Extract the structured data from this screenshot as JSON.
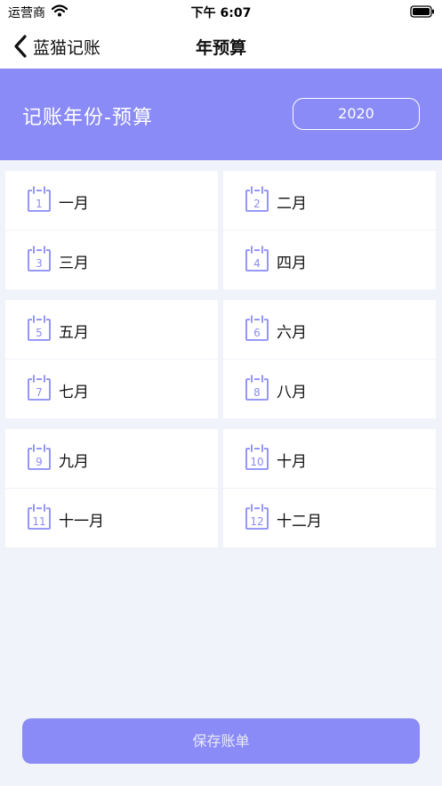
{
  "status_bar": {
    "carrier": "运营商",
    "time": "下午 6:07"
  },
  "nav": {
    "back_label": "蓝猫记账",
    "title": "年预算"
  },
  "banner": {
    "title": "记账年份-预算",
    "year": "2020"
  },
  "months": [
    {
      "num": "1",
      "label": "一月"
    },
    {
      "num": "2",
      "label": "二月"
    },
    {
      "num": "3",
      "label": "三月"
    },
    {
      "num": "4",
      "label": "四月"
    },
    {
      "num": "5",
      "label": "五月"
    },
    {
      "num": "6",
      "label": "六月"
    },
    {
      "num": "7",
      "label": "七月"
    },
    {
      "num": "8",
      "label": "八月"
    },
    {
      "num": "9",
      "label": "九月"
    },
    {
      "num": "10",
      "label": "十月"
    },
    {
      "num": "11",
      "label": "十一月"
    },
    {
      "num": "12",
      "label": "十二月"
    }
  ],
  "save_label": "保存账单",
  "colors": {
    "accent": "#8a8bf6",
    "background": "#f1f3fa"
  },
  "icons": {
    "wifi": "wifi-icon",
    "battery": "battery-icon",
    "back": "chevron-left-icon",
    "month": "calendar-icon"
  }
}
